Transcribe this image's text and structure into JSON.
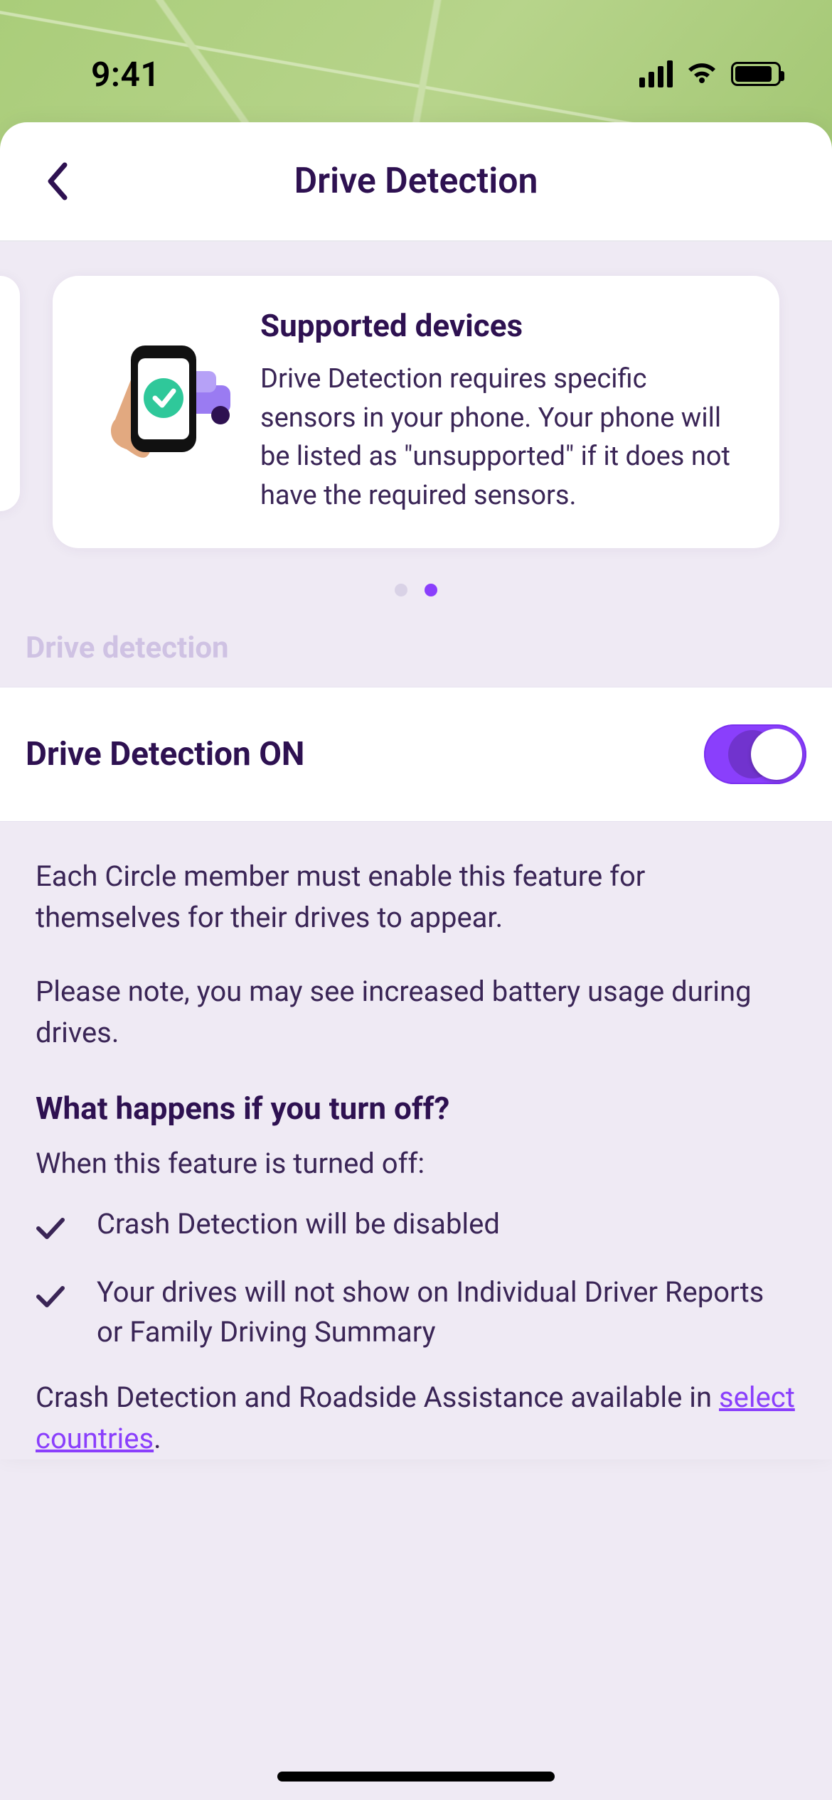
{
  "status": {
    "time": "9:41"
  },
  "header": {
    "title": "Drive Detection"
  },
  "carousel": {
    "card": {
      "title": "Supported devices",
      "body": "Drive Detection requires specific sensors in your phone. Your phone will be listed as \"unsupported\" if it does not have the required sensors."
    },
    "active_index": 1,
    "total": 2
  },
  "section_label": "Drive detection",
  "toggle": {
    "label": "Drive Detection ON",
    "on": true
  },
  "info": {
    "p1": "Each Circle member must enable this feature for themselves for their drives to appear.",
    "p2": "Please note, you may see increased battery usage during drives.",
    "heading": "What happens if you turn off?",
    "sub": "When this feature is turned off:",
    "bullets": [
      "Crash Detection will be disabled",
      "Your drives will not show on Individual Driver Reports or Family Driving Summary"
    ],
    "footer_pre": "Crash Detection and Roadside Assistance available in ",
    "footer_link": "select countries",
    "footer_post": "."
  }
}
